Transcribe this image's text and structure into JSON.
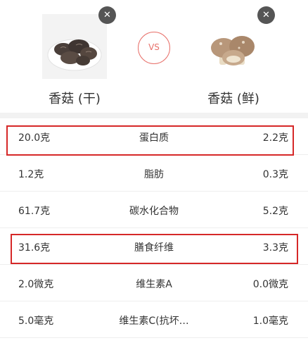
{
  "compare": {
    "left_food": {
      "name": "香菇 (干)",
      "image_icon": "dried-shiitake-photo",
      "remove_icon": "close-icon"
    },
    "right_food": {
      "name": "香菇 (鲜)",
      "image_icon": "fresh-shiitake-photo",
      "remove_icon": "close-icon"
    },
    "vs_label": "VS"
  },
  "nutrients": [
    {
      "left": "20.0克",
      "label": "蛋白质",
      "right": "2.2克",
      "highlighted": true
    },
    {
      "left": "1.2克",
      "label": "脂肪",
      "right": "0.3克",
      "highlighted": false
    },
    {
      "left": "61.7克",
      "label": "碳水化合物",
      "right": "5.2克",
      "highlighted": false
    },
    {
      "left": "31.6克",
      "label": "膳食纤维",
      "right": "3.3克",
      "highlighted": true
    },
    {
      "left": "2.0微克",
      "label": "维生素A",
      "right": "0.0微克",
      "highlighted": false
    },
    {
      "left": "5.0毫克",
      "label": "维生素C(抗坏…",
      "right": "1.0毫克",
      "highlighted": false
    }
  ],
  "colors": {
    "accent": "#e8716b",
    "highlight_box": "#d62828",
    "close_button": "#555555"
  }
}
